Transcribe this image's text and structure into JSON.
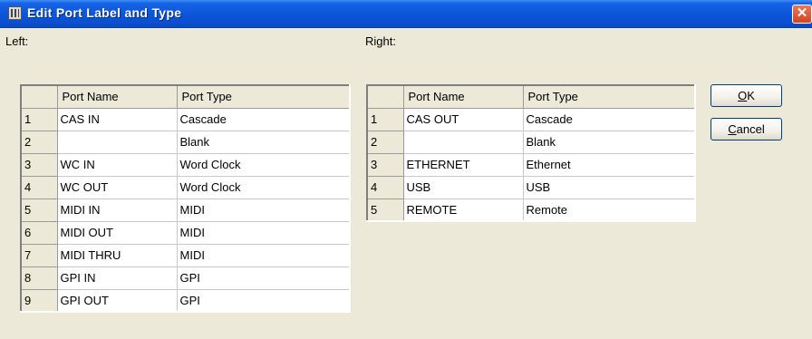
{
  "window": {
    "title": "Edit Port Label and Type",
    "app_icon": "port-editor-icon",
    "close_glyph": "✕"
  },
  "left": {
    "label": "Left:",
    "columns": [
      "Port Name",
      "Port Type"
    ],
    "rows": [
      {
        "num": "1",
        "name": "CAS IN",
        "type": "Cascade"
      },
      {
        "num": "2",
        "name": "",
        "type": "Blank"
      },
      {
        "num": "3",
        "name": "WC IN",
        "type": "Word Clock"
      },
      {
        "num": "4",
        "name": "WC OUT",
        "type": "Word Clock"
      },
      {
        "num": "5",
        "name": "MIDI IN",
        "type": "MIDI"
      },
      {
        "num": "6",
        "name": "MIDI OUT",
        "type": "MIDI"
      },
      {
        "num": "7",
        "name": "MIDI THRU",
        "type": "MIDI"
      },
      {
        "num": "8",
        "name": "GPI IN",
        "type": "GPI"
      },
      {
        "num": "9",
        "name": "GPI OUT",
        "type": "GPI"
      }
    ]
  },
  "right": {
    "label": "Right:",
    "columns": [
      "Port Name",
      "Port Type"
    ],
    "rows": [
      {
        "num": "1",
        "name": "CAS OUT",
        "type": "Cascade"
      },
      {
        "num": "2",
        "name": "",
        "type": "Blank"
      },
      {
        "num": "3",
        "name": "ETHERNET",
        "type": "Ethernet"
      },
      {
        "num": "4",
        "name": "USB",
        "type": "USB"
      },
      {
        "num": "5",
        "name": "REMOTE",
        "type": "Remote"
      }
    ]
  },
  "buttons": {
    "ok": {
      "mnemonic": "O",
      "rest": "K"
    },
    "cancel": {
      "mnemonic": "C",
      "rest": "ancel"
    }
  },
  "colors": {
    "titlebar": "#0a55d8",
    "dialog_bg": "#ece9d8",
    "close": "#d2451e"
  }
}
